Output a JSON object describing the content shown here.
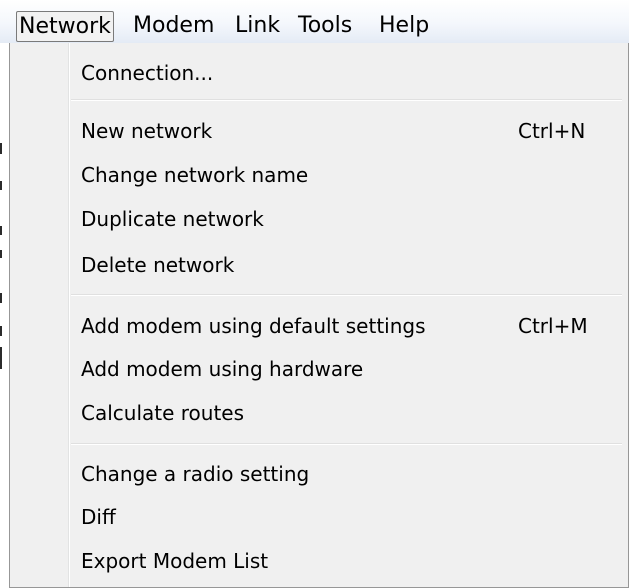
{
  "menubar": {
    "items": [
      {
        "label": "Network",
        "active": true
      },
      {
        "label": "Modem"
      },
      {
        "label": "Link"
      },
      {
        "label": "Tools"
      },
      {
        "label": "Help"
      }
    ]
  },
  "dropdown": {
    "groups": [
      [
        {
          "label": "Connection..."
        }
      ],
      [
        {
          "label": "New network",
          "shortcut": "Ctrl+N"
        },
        {
          "label": "Change network name"
        },
        {
          "label": "Duplicate network"
        },
        {
          "label": "Delete network"
        }
      ],
      [
        {
          "label": "Add modem using default settings",
          "shortcut": "Ctrl+M"
        },
        {
          "label": "Add modem using hardware"
        },
        {
          "label": "Calculate routes"
        }
      ],
      [
        {
          "label": "Change a radio setting"
        },
        {
          "label": "Diff"
        },
        {
          "label": "Export Modem List"
        }
      ]
    ]
  }
}
